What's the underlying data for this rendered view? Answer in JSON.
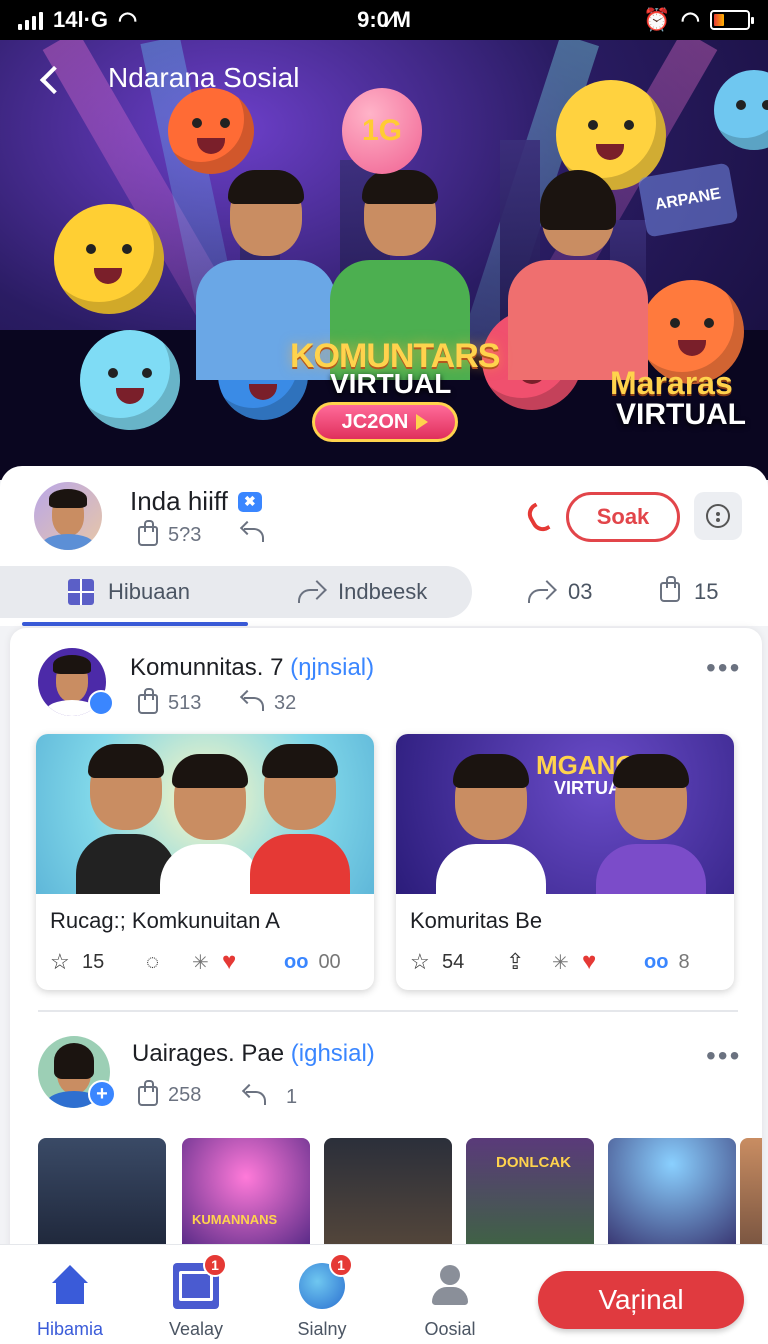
{
  "status_bar": {
    "signal": "14l·G",
    "time": "9:0⁄M"
  },
  "hero": {
    "title": "Ndarana Sosial",
    "headline": "KOMUNTARS",
    "headline_sub": "VIRTUAL",
    "pill_label": "JC2ON",
    "right_headline": "Mararas",
    "right_sub": "VIRTUAL",
    "sign_text": "ARPANE",
    "bubble_text": "1G"
  },
  "profile": {
    "name": "Inda hiiff",
    "likes": "5?3",
    "action_label": "Soak"
  },
  "tabs": {
    "tab1": "Hibuaan",
    "tab2": "Indbeesk",
    "shares": "03",
    "likes": "15"
  },
  "post1": {
    "name": "Komunnitas. 7 ",
    "tag": "(ŋjnsial)",
    "likes": "513",
    "replies": "32",
    "cards": [
      {
        "title": "Rucag:; Komkunuitan A",
        "stars": "15",
        "views": "00"
      },
      {
        "title": "Komuritas Be",
        "stars": "54",
        "views": "8",
        "banner": "MGANG",
        "banner_sub": "VIRTUAL"
      }
    ]
  },
  "post2": {
    "name": "Uairages. Pae ",
    "tag": "(ighsial)",
    "likes": "258",
    "replies": "1",
    "thumb_labels": [
      "DONLCAK",
      "KUMANNANS"
    ]
  },
  "bottom_nav": {
    "items": [
      {
        "label": "Hibamia"
      },
      {
        "label": "Vealay",
        "badge": "1"
      },
      {
        "label": "Sialny",
        "badge": "1"
      },
      {
        "label": "Oosial"
      }
    ],
    "cta": "Vaŗinal"
  },
  "colors": {
    "accent": "#3a5bd9",
    "cta": "#e03a3f",
    "tag": "#3a86ff"
  }
}
